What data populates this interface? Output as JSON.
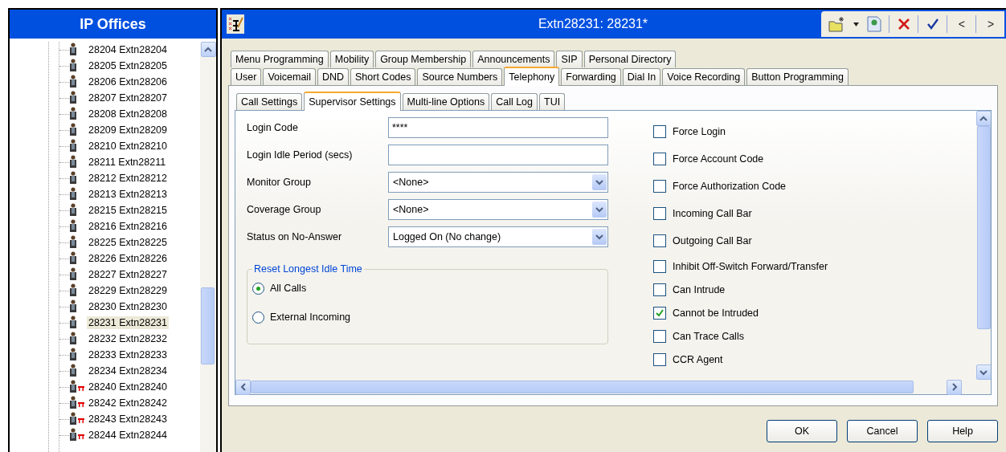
{
  "sidebar": {
    "title": "IP Offices",
    "items": [
      {
        "label": "28204 Extn28204",
        "selected": false,
        "kind": "user"
      },
      {
        "label": "28205 Extn28205",
        "selected": false,
        "kind": "user"
      },
      {
        "label": "28206 Extn28206",
        "selected": false,
        "kind": "user"
      },
      {
        "label": "28207 Extn28207",
        "selected": false,
        "kind": "user"
      },
      {
        "label": "28208 Extn28208",
        "selected": false,
        "kind": "user"
      },
      {
        "label": "28209 Extn28209",
        "selected": false,
        "kind": "user"
      },
      {
        "label": "28210 Extn28210",
        "selected": false,
        "kind": "user"
      },
      {
        "label": "28211 Extn28211",
        "selected": false,
        "kind": "user"
      },
      {
        "label": "28212 Extn28212",
        "selected": false,
        "kind": "user"
      },
      {
        "label": "28213 Extn28213",
        "selected": false,
        "kind": "user"
      },
      {
        "label": "28215 Extn28215",
        "selected": false,
        "kind": "user"
      },
      {
        "label": "28216 Extn28216",
        "selected": false,
        "kind": "user"
      },
      {
        "label": "28225 Extn28225",
        "selected": false,
        "kind": "user"
      },
      {
        "label": "28226 Extn28226",
        "selected": false,
        "kind": "user"
      },
      {
        "label": "28227 Extn28227",
        "selected": false,
        "kind": "user"
      },
      {
        "label": "28229 Extn28229",
        "selected": false,
        "kind": "user"
      },
      {
        "label": "28230 Extn28230",
        "selected": false,
        "kind": "user"
      },
      {
        "label": "28231 Extn28231",
        "selected": true,
        "kind": "user"
      },
      {
        "label": "28232 Extn28232",
        "selected": false,
        "kind": "user"
      },
      {
        "label": "28233 Extn28233",
        "selected": false,
        "kind": "user"
      },
      {
        "label": "28234 Extn28234",
        "selected": false,
        "kind": "user"
      },
      {
        "label": "28240 Extn28240",
        "selected": false,
        "kind": "flagged"
      },
      {
        "label": "28242 Extn28242",
        "selected": false,
        "kind": "flagged"
      },
      {
        "label": "28243 Extn28243",
        "selected": false,
        "kind": "flagged"
      },
      {
        "label": "28244 Extn28244",
        "selected": false,
        "kind": "flagged"
      }
    ]
  },
  "editor": {
    "title": "Extn28231: 28231*",
    "toolbar": {
      "nav": [
        "<",
        ">"
      ]
    },
    "tab_rows": [
      [
        {
          "label": "Menu Programming",
          "selected": false
        },
        {
          "label": "Mobility",
          "selected": false
        },
        {
          "label": "Group Membership",
          "selected": false
        },
        {
          "label": "Announcements",
          "selected": false
        },
        {
          "label": "SIP",
          "selected": false
        },
        {
          "label": "Personal Directory",
          "selected": false
        }
      ],
      [
        {
          "label": "User",
          "selected": false
        },
        {
          "label": "Voicemail",
          "selected": false
        },
        {
          "label": "DND",
          "selected": false
        },
        {
          "label": "Short Codes",
          "selected": false
        },
        {
          "label": "Source Numbers",
          "selected": false
        },
        {
          "label": "Telephony",
          "selected": true
        },
        {
          "label": "Forwarding",
          "selected": false
        },
        {
          "label": "Dial In",
          "selected": false
        },
        {
          "label": "Voice Recording",
          "selected": false
        },
        {
          "label": "Button Programming",
          "selected": false
        }
      ]
    ],
    "subtabs": [
      {
        "label": "Call Settings",
        "selected": false
      },
      {
        "label": "Supervisor Settings",
        "selected": true
      },
      {
        "label": "Multi-line Options",
        "selected": false
      },
      {
        "label": "Call Log",
        "selected": false
      },
      {
        "label": "TUI",
        "selected": false
      }
    ],
    "fields": [
      {
        "kind": "text",
        "label": "Login Code",
        "value": "****"
      },
      {
        "kind": "text",
        "label": "Login Idle Period (secs)"
      },
      {
        "kind": "select",
        "label": "Monitor Group",
        "value": "<None>"
      },
      {
        "kind": "select",
        "label": "Coverage Group",
        "value": "<None>"
      },
      {
        "kind": "select",
        "label": "Status on No-Answer",
        "value": "Logged On (No change)"
      }
    ],
    "reset_group": {
      "title": "Reset Longest Idle Time",
      "options": [
        {
          "label": "All Calls",
          "selected": true
        },
        {
          "label": "External Incoming",
          "selected": false
        }
      ]
    },
    "checkboxes": [
      {
        "label": "Force Login",
        "checked": false
      },
      {
        "label": "Force Account Code",
        "checked": false
      },
      {
        "label": "Force Authorization Code",
        "checked": false
      },
      {
        "label": "Incoming Call Bar",
        "checked": false
      },
      {
        "label": "Outgoing Call Bar",
        "checked": false
      },
      {
        "label": "Inhibit Off-Switch Forward/Transfer",
        "checked": false
      },
      {
        "label": "Can Intrude",
        "checked": false
      },
      {
        "label": "Cannot be Intruded",
        "checked": true
      },
      {
        "label": "Can Trace Calls",
        "checked": false
      },
      {
        "label": "CCR Agent",
        "checked": false
      }
    ],
    "buttons": [
      "OK",
      "Cancel",
      "Help"
    ]
  }
}
